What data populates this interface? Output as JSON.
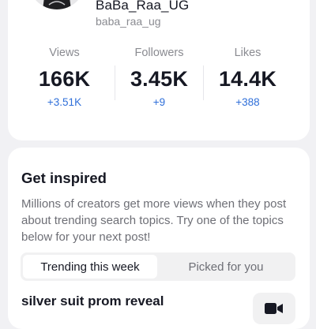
{
  "profile": {
    "display_name": "BaBa_Raa_UG",
    "handle": "baba_raa_ug",
    "avatar_icon": "profile-photo"
  },
  "stats": [
    {
      "label": "Views",
      "value": "166K",
      "delta": "+3.51K"
    },
    {
      "label": "Followers",
      "value": "3.45K",
      "delta": "+9"
    },
    {
      "label": "Likes",
      "value": "14.4K",
      "delta": "+388"
    }
  ],
  "inspire": {
    "title": "Get inspired",
    "description": "Millions of creators get more views when they post about trending search topics. Try one of the topics below for your next post!",
    "tabs": [
      {
        "label": "Trending this week",
        "active": true
      },
      {
        "label": "Picked for you",
        "active": false
      }
    ],
    "topic": {
      "title": "silver suit prom reveal",
      "icon": "video-camera-icon"
    }
  },
  "colors": {
    "accent_delta": "#2f6fd9",
    "background": "#f1f1f4",
    "card": "#ffffff"
  }
}
